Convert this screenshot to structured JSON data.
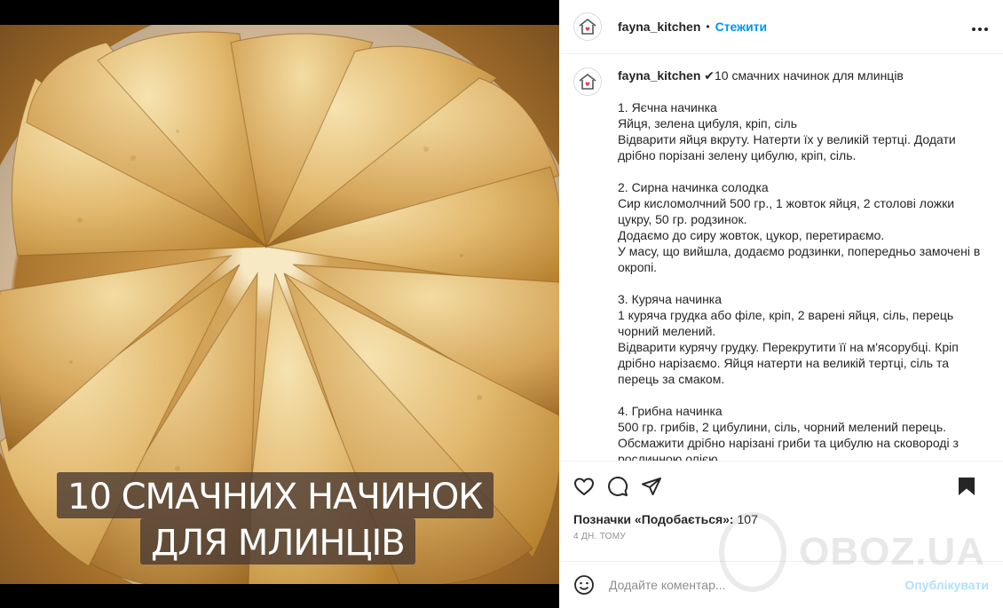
{
  "photo": {
    "caption_line1": "10 СМАЧНИХ НАЧИНОК",
    "caption_line2": "ДЛЯ МЛИНЦІВ"
  },
  "header": {
    "username": "fayna_kitchen",
    "separator": "•",
    "follow_label": "Стежити",
    "more_icon": "more-horizontal-icon"
  },
  "post": {
    "username": "fayna_kitchen",
    "title": "✔10 смачних начинок для млинців",
    "sections": [
      {
        "lines": [
          "1. Яєчна начинка",
          "Яйця, зелена цибуля, кріп, сіль",
          "Відварити яйця вкруту. Натерти їх у великій тертці. Додати дрібно порізані зелену цибулю, кріп, сіль."
        ]
      },
      {
        "lines": [
          "2. Сирна начинка солодка",
          "Сир кисломолчний 500 гр., 1 жовток яйця, 2 столові ложки цукру, 50 гр. родзинок.",
          "Додаємо до сиру жовток, цукор, перетираємо.",
          "У масу, що вийшла, додаємо родзинки, попередньо замочені в окропі."
        ]
      },
      {
        "lines": [
          "3. Куряча начинка",
          "1 куряча грудка або філе, кріп, 2 варені яйця, сіль, перець чорний мелений.",
          "Відварити курячу грудку. Перекрутити її на м'ясорубці. Кріп дрібно нарізаємо. Яйця натерти на великій тертці, сіль та перець за смаком."
        ]
      },
      {
        "lines": [
          "4. Грибна начинка",
          "500 гр. грибів, 2 цибулини, сіль, чорний мелений перець.",
          "Обсмажити дрібно нарізані гриби та цибулю на сковороді з рослинною олією."
        ]
      }
    ]
  },
  "actions": {
    "likes_label": "Позначки «Подобається»:",
    "likes_count": "107",
    "time": "4 ДН. ТОМУ"
  },
  "comment": {
    "placeholder": "Додайте коментар...",
    "post_label": "Опублікувати"
  },
  "watermark": {
    "text": "OBOZ.UA"
  },
  "colors": {
    "accent": "#0095f6",
    "post_disabled": "#b2dffc",
    "secondary_text": "#8e8e8e"
  }
}
